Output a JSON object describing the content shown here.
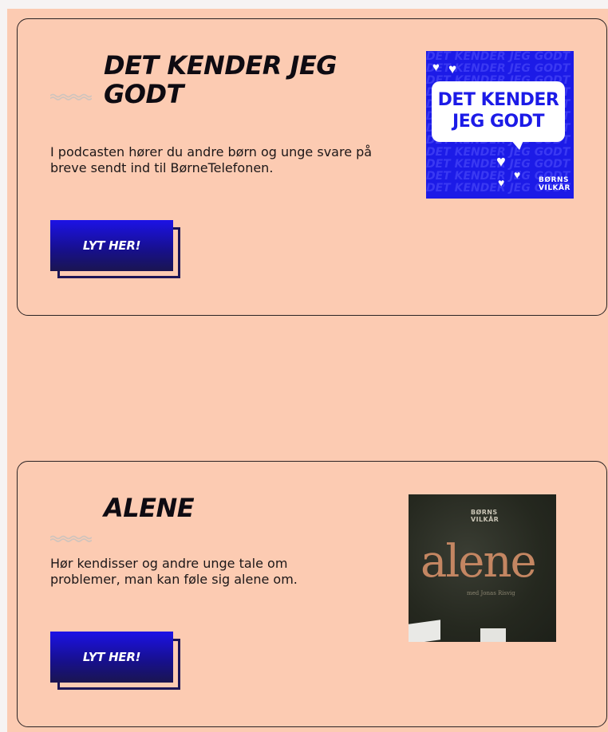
{
  "podcasts": [
    {
      "title": "DET KENDER JEG GODT",
      "description": "I podcasten hører du andre børn og unge svare på breve sendt ind til BørneTelefonen.",
      "button_label": "LYT HER!",
      "cover": {
        "title_line1": "DET KENDER",
        "title_line2": "JEG GODT",
        "background_text": "DET KENDER JEG GODT",
        "brand_line1": "BØRNS",
        "brand_line2": "VILKÅR"
      }
    },
    {
      "title": "ALENE",
      "description": "Hør kendisser og andre unge tale om problemer, man kan føle sig alene om.",
      "button_label": "LYT HER!",
      "cover": {
        "word": "alene",
        "sub": "med Jonas Risvig",
        "brand_line1": "BØRNS",
        "brand_line2": "VILKÅR"
      }
    }
  ],
  "colors": {
    "page_background": "#fccbb2",
    "button_blue": "#1c12e6",
    "cover_blue": "#1c1be7",
    "text_dark": "#0e0b12"
  }
}
